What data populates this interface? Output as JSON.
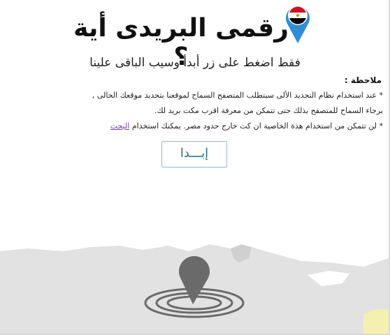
{
  "header": {
    "title": "رقمى البريدى أية ؟"
  },
  "subtitle": "فقط اضغط على زر أبدأ وسيب الباقى علينا",
  "note": {
    "title": "ملاحظة :",
    "line1": "* عند استخدام نظام التحديد الألى سيتطلب المتصفح السماح لموقعنا بتحديد موقعك الحالى ,",
    "line2": "برجاء السماح للمتصفح بذلك حتى تتمكن من معرفة اقرب مكت بريد لك.",
    "line3_prefix": "* لن تتمكن من استخدام هذة الخاصية ان كت خارج حدود مصر. يمكنك استخدام ",
    "line3_link": "البحث"
  },
  "start_button": {
    "label": "إبـــدا"
  },
  "colors": {
    "button_border": "#8fb8d4",
    "button_text": "#2a6fa0",
    "pin_blue": "#2e8fd6",
    "link": "#7a3ea8",
    "map_land": "#e2e2e2"
  },
  "icons": {
    "flag_pin": "egypt-flag-pin-icon",
    "location": "location-pin-icon"
  }
}
